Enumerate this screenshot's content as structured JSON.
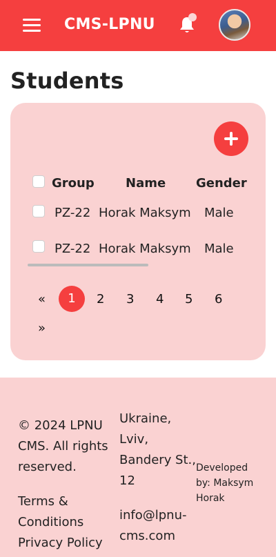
{
  "header": {
    "brand": "CMS-LPNU",
    "icons": {
      "menu": "hamburger-menu-icon",
      "notifications": "bell-icon"
    }
  },
  "page": {
    "title": "Students"
  },
  "table": {
    "columns": [
      "Group",
      "Name",
      "Gender"
    ],
    "rows": [
      {
        "group": "PZ-22",
        "name": "Horak Maksym",
        "gender": "Male"
      },
      {
        "group": "PZ-22",
        "name": "Horak Maksym",
        "gender": "Male"
      }
    ]
  },
  "pagination": {
    "prev": "«",
    "next": "»",
    "pages": [
      "1",
      "2",
      "3",
      "4",
      "5",
      "6"
    ],
    "current": "1"
  },
  "footer": {
    "copyright_lines": [
      "© 2024 LPNU",
      "CMS. All rights",
      "reserved."
    ],
    "terms": "Terms &",
    "terms2": "Conditions",
    "privacy": "Privacy Policy",
    "address_lines": [
      "Ukraine,",
      "Lviv,",
      "Bandery St.,",
      "12"
    ],
    "email_lines": [
      "info@lpnu-",
      "cms.com"
    ],
    "developer_lines": [
      "Developed",
      "by: Maksym",
      "Horak"
    ]
  },
  "colors": {
    "accent": "#f53f3f",
    "card_bg": "#fad2d2"
  }
}
